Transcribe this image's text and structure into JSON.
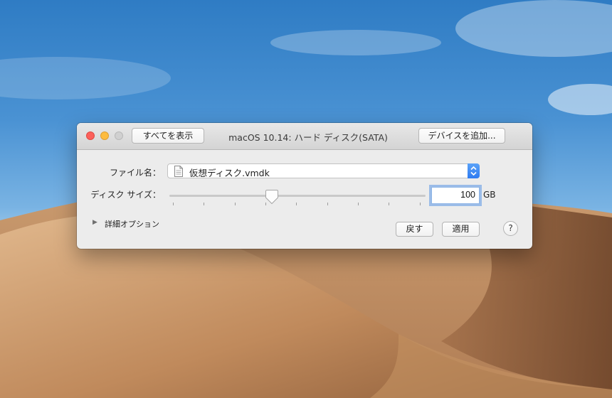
{
  "window": {
    "title": "macOS 10.14: ハード ディスク(SATA)",
    "show_all_label": "すべてを表示",
    "add_device_label": "デバイスを追加..."
  },
  "file": {
    "label": "ファイル名：",
    "value": "仮想ディスク.vmdk"
  },
  "disk_size": {
    "label": "ディスク サイズ：",
    "value": "100",
    "unit": "GB",
    "slider_fraction": 0.4
  },
  "advanced": {
    "label": "詳細オプション"
  },
  "buttons": {
    "revert_label": "戻す",
    "apply_label": "適用",
    "help_label": "?"
  },
  "colors": {
    "close": "#fc605b",
    "minimize": "#fdbc40",
    "accent": "#2f7bf1",
    "focus_ring": "#5a96e6"
  }
}
